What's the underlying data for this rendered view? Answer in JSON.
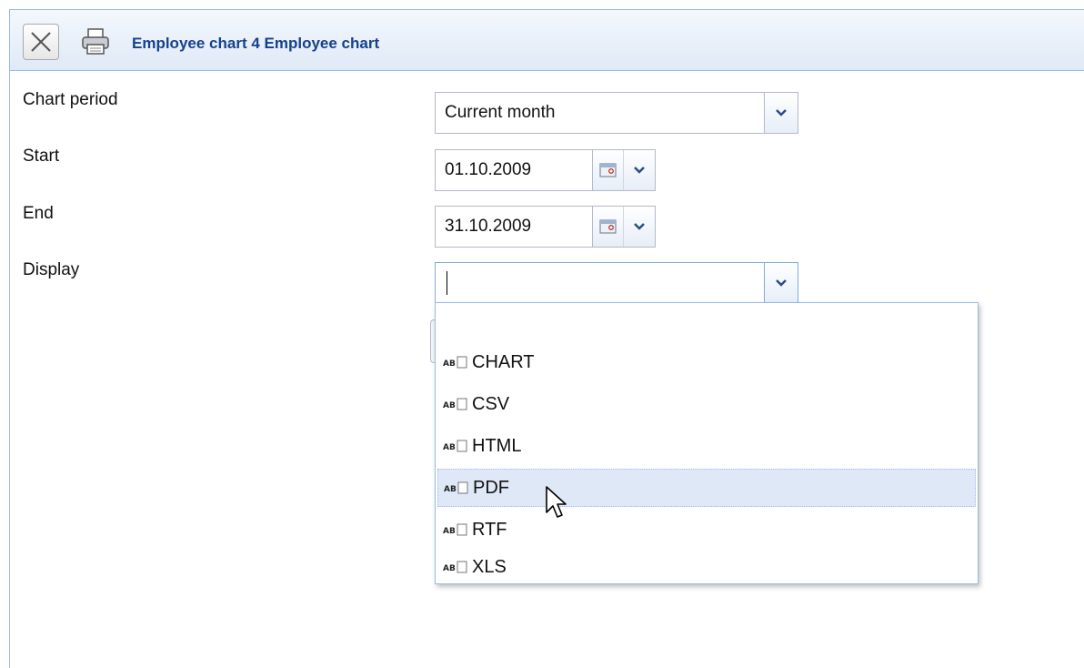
{
  "window": {
    "title": "Employee chart 4 Employee chart"
  },
  "toolbar": {
    "close_icon": "close-x-icon",
    "print_icon": "printer-icon"
  },
  "form": {
    "chart_period": {
      "label": "Chart period",
      "value": "Current month"
    },
    "start": {
      "label": "Start",
      "value": "01.10.2009"
    },
    "end": {
      "label": "End",
      "value": "31.10.2009"
    },
    "display": {
      "label": "Display",
      "value": ""
    }
  },
  "display_options": {
    "items": [
      {
        "label": "CHART",
        "icon": "text-field-icon"
      },
      {
        "label": "CSV",
        "icon": "text-field-icon"
      },
      {
        "label": "HTML",
        "icon": "text-field-icon"
      },
      {
        "label": "PDF",
        "icon": "text-field-icon",
        "hovered": true
      },
      {
        "label": "RTF",
        "icon": "text-field-icon"
      },
      {
        "label": "XLS",
        "icon": "text-field-icon"
      }
    ]
  },
  "colors": {
    "title": "#15428b",
    "border": "#99bbe8",
    "hover": "#dfe8f6"
  }
}
